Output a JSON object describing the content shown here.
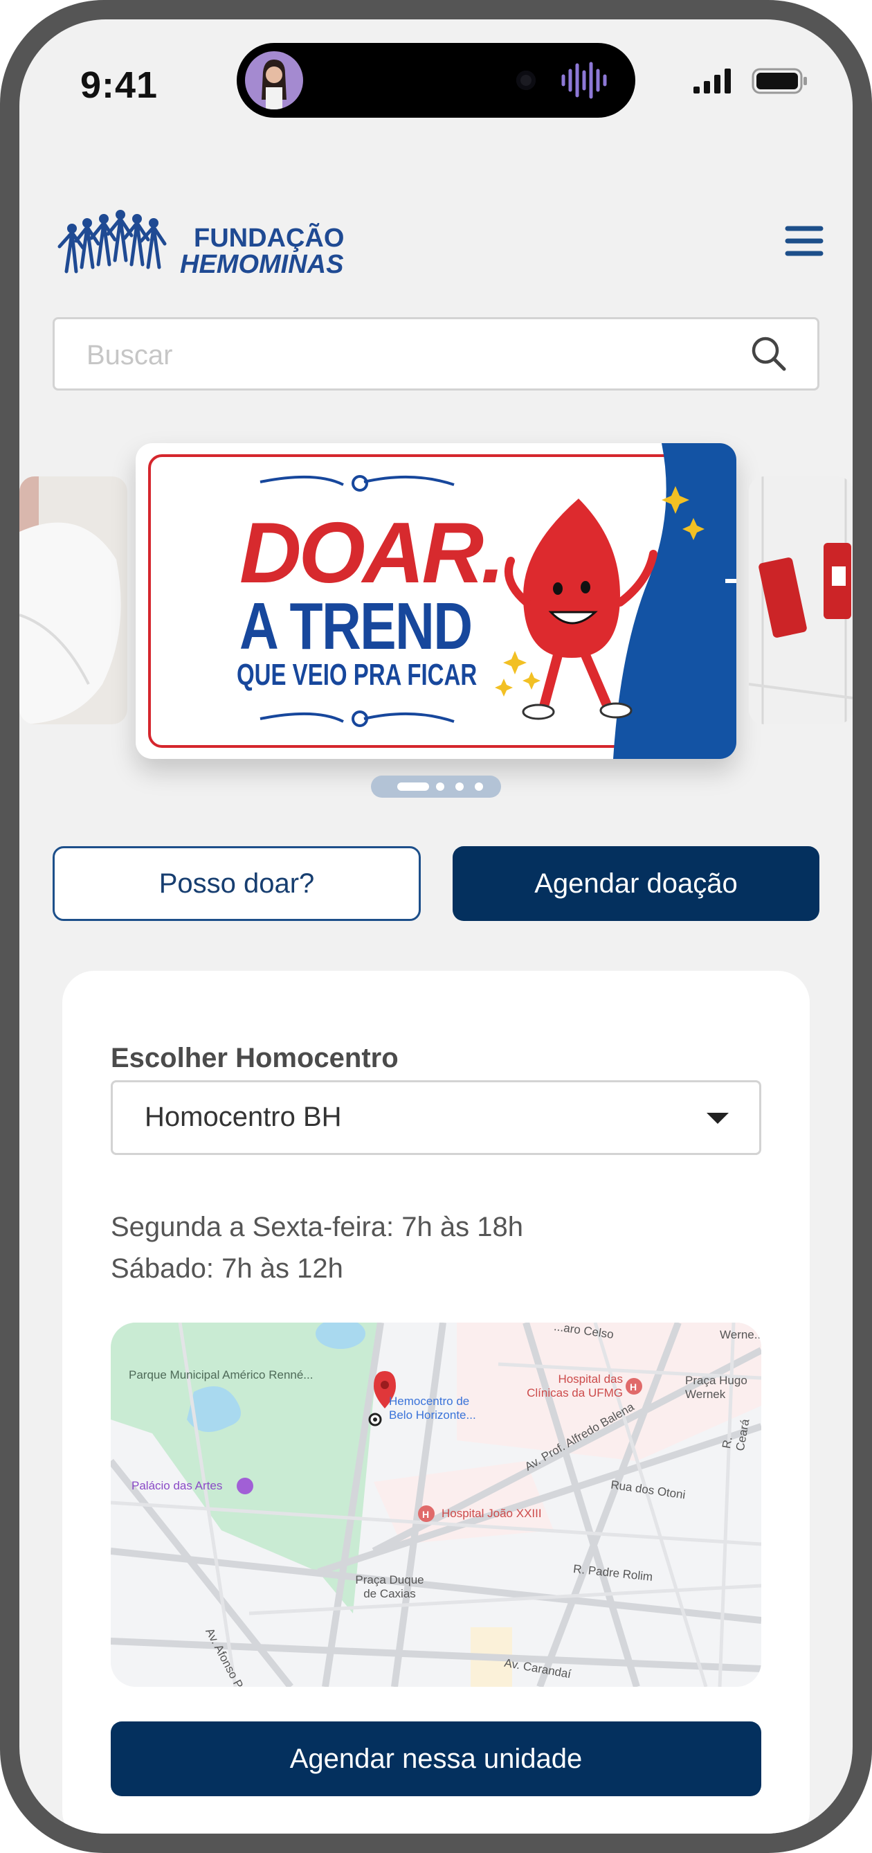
{
  "status_bar": {
    "time": "9:41"
  },
  "header": {
    "logo_line1": "FUNDAÇÃO",
    "logo_line2": "HEMOMINAS"
  },
  "search": {
    "placeholder": "Buscar"
  },
  "carousel": {
    "banner_line1": "DOAR.",
    "banner_line2": "A TREND",
    "banner_line3": "QUE VEIO PRA FICAR",
    "slides_count": 4,
    "active_slide": 1
  },
  "actions": {
    "can_donate_label": "Posso doar?",
    "schedule_label": "Agendar doação"
  },
  "center_card": {
    "title": "Escolher Homocentro",
    "selected_center": "Homocentro BH",
    "hours_weekdays": "Segunda a Sexta-feira: 7h às 18h",
    "hours_saturday": "Sábado: 7h às 12h",
    "schedule_here_label": "Agendar nessa unidade"
  },
  "map": {
    "park_label": "Parque Municipal Américo Renné...",
    "pin_label": "Hemocentro de Belo Horizonte...",
    "hospital_clinicas": "Hospital das Clínicas da UFMG",
    "palacio": "Palácio das Artes",
    "hospital_joao": "Hospital João XXIII",
    "praca_duque": "Praça Duque de Caxias",
    "praca_hugo": "Praça Hugo Wernek",
    "street_alfredo": "Av. Prof. Alfredo Balena",
    "street_otoni": "Rua dos Otoni",
    "street_padre": "R. Padre Rolim",
    "street_ceara": "R. Ceará",
    "street_afonso": "Av. Afonso Pena",
    "street_carandai": "Av. Carandaí",
    "street_celso": "...aro Celso",
    "street_wernek": "Werne..."
  },
  "colors": {
    "primary": "#04305e",
    "accent_red": "#d72a2e",
    "brand_blue": "#17479c"
  }
}
